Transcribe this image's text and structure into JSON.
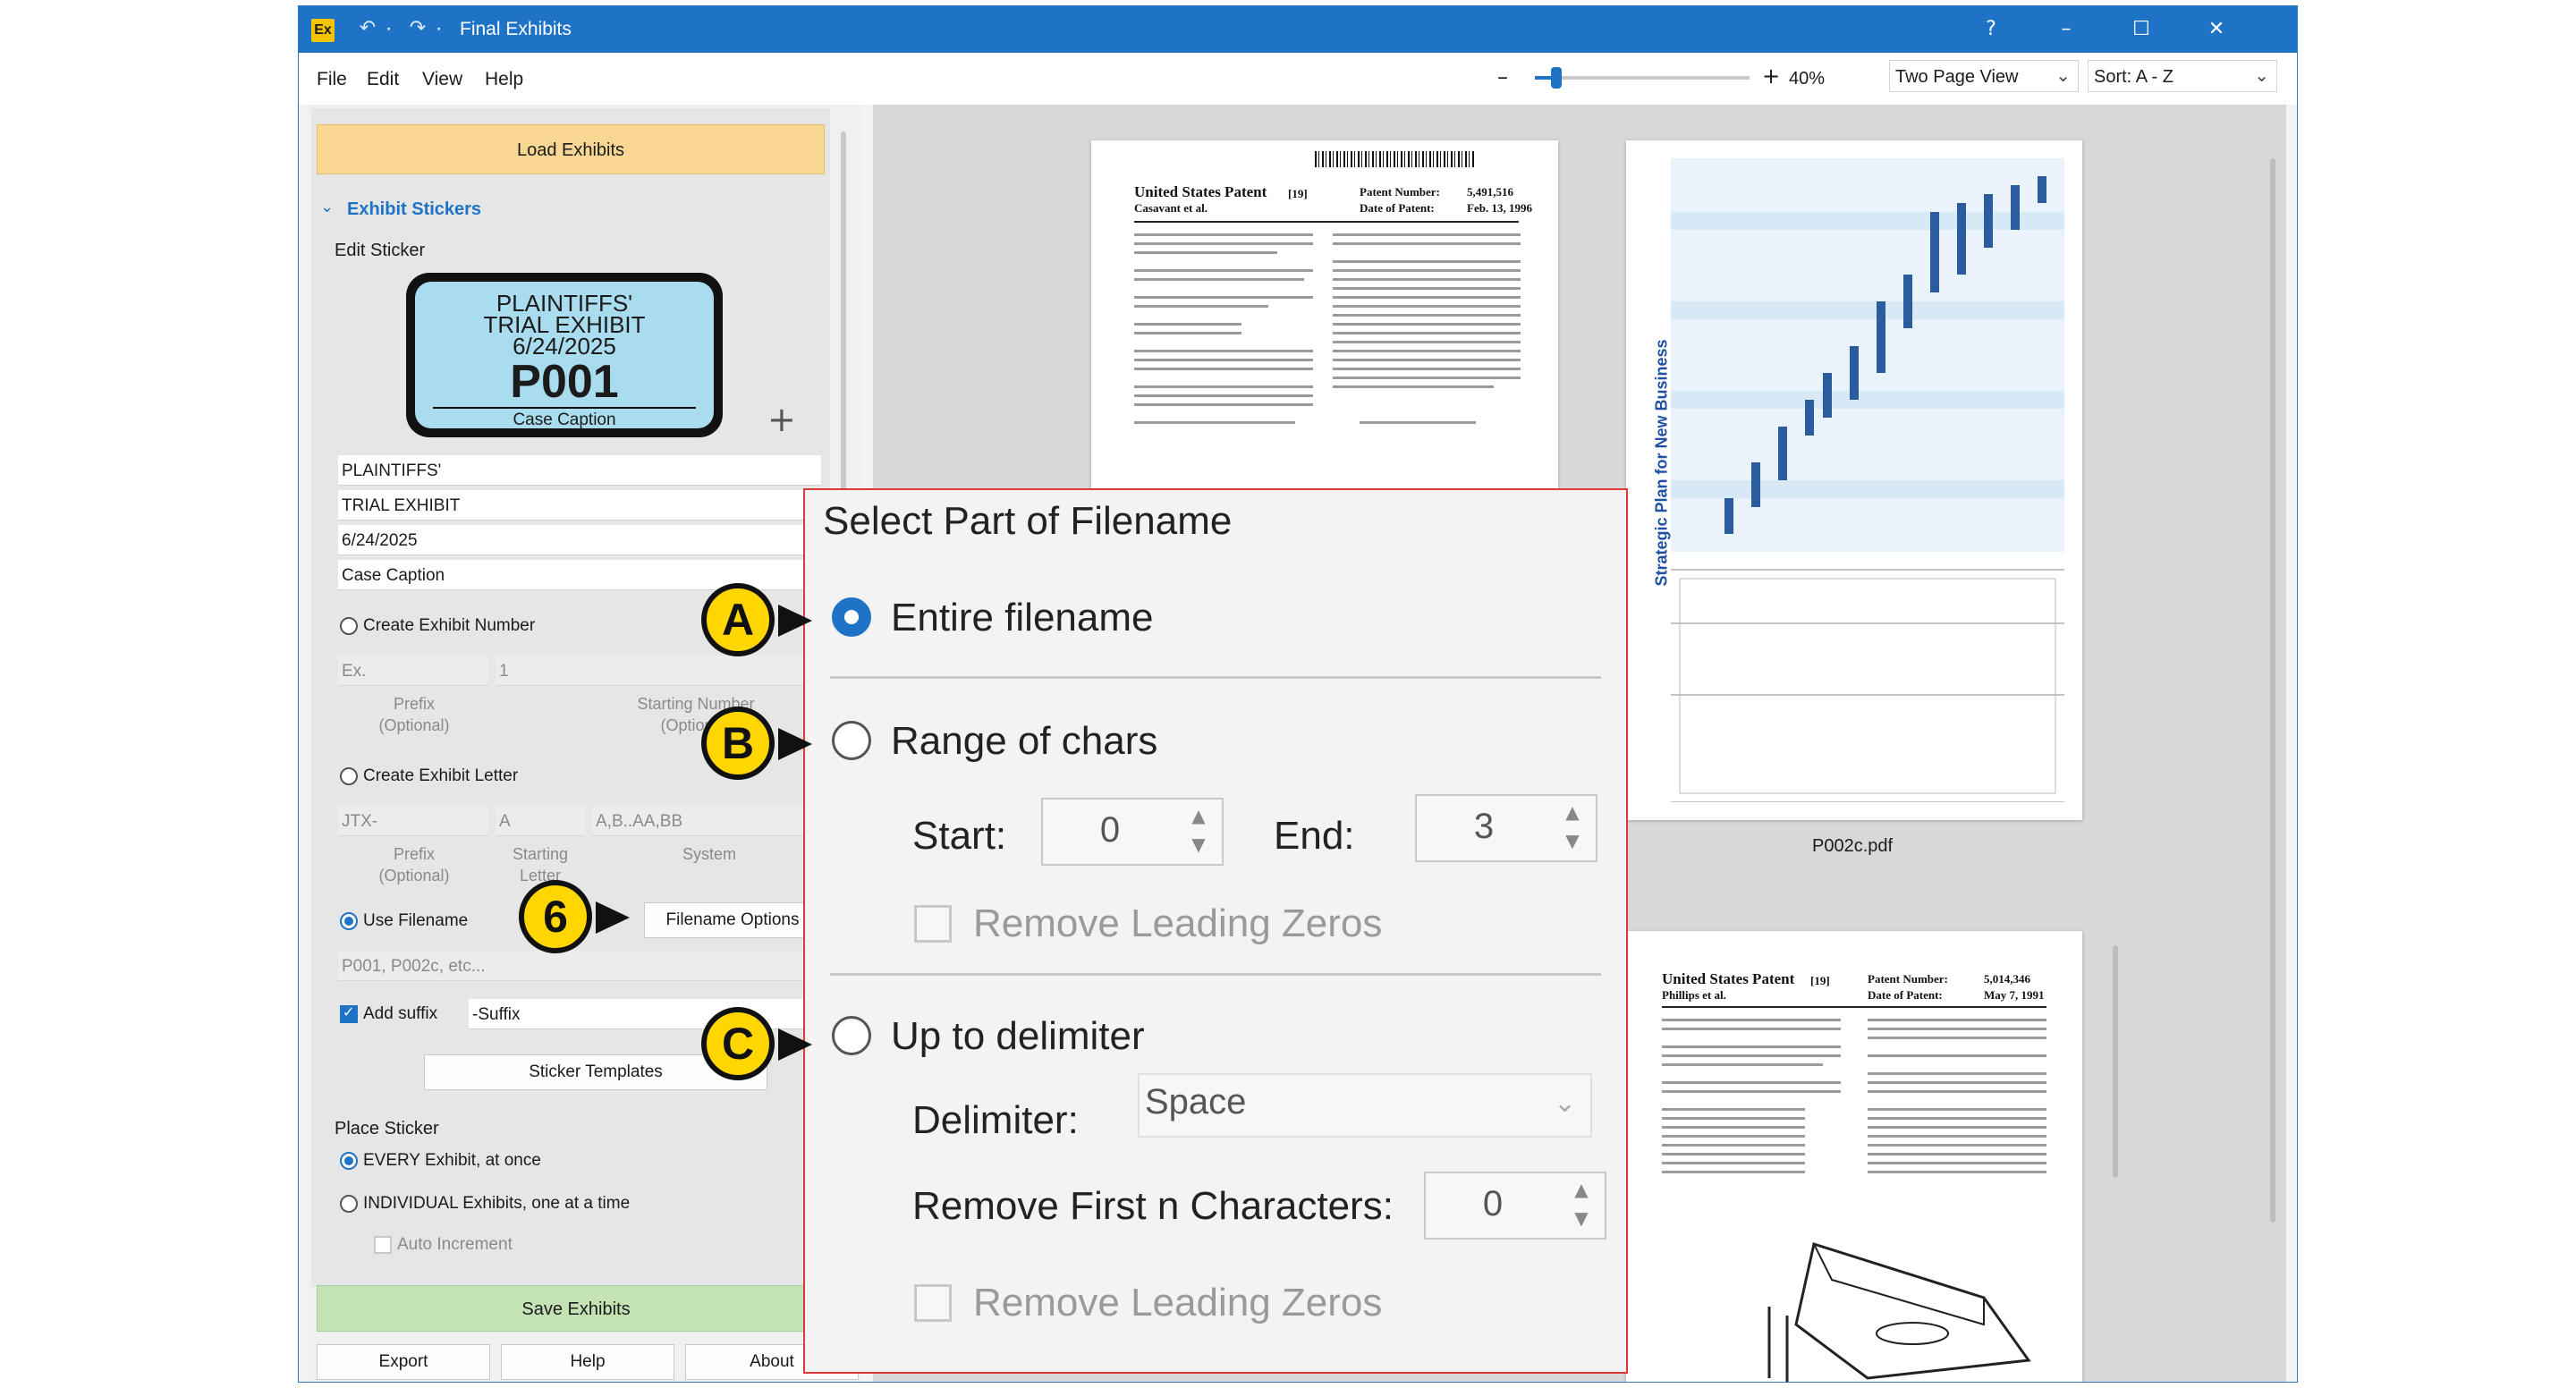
{
  "window": {
    "title": "Final Exhibits",
    "logo": "Ex",
    "controls": {
      "help": "?",
      "minimize": "–",
      "maximize": "☐",
      "close": "✕"
    }
  },
  "menu": {
    "file": "File",
    "edit": "Edit",
    "view": "View",
    "help": "Help"
  },
  "toolbar": {
    "zoom_minus": "–",
    "zoom_plus": "+",
    "zoom_value": "40%",
    "zoom_level": 0.1,
    "view_mode": "Two Page View",
    "sort": "Sort: A - Z"
  },
  "left_panel": {
    "load_button": "Load Exhibits",
    "section_title": "Exhibit Stickers",
    "edit_sticker_label": "Edit Sticker",
    "sticker": {
      "line1": "PLAINTIFFS'",
      "line2": "TRIAL EXHIBIT",
      "line3": "6/24/2025",
      "number": "P001",
      "caption": "Case Caption"
    },
    "fields": {
      "line1": "PLAINTIFFS'",
      "line2": "TRIAL EXHIBIT",
      "line3": "6/24/2025",
      "line4": "Case Caption"
    },
    "create_number": {
      "label": "Create Exhibit Number",
      "prefix_value": "Ex.",
      "start_value": "1",
      "prefix_caption_1": "Prefix",
      "prefix_caption_2": "(Optional)",
      "start_caption_1": "Starting Number",
      "start_caption_2": "(Optional)"
    },
    "create_letter": {
      "label": "Create Exhibit Letter",
      "prefix_value": "JTX-",
      "start_value": "A",
      "system_value": "A,B..AA,BB",
      "prefix_caption_1": "Prefix",
      "prefix_caption_2": "(Optional)",
      "start_caption_1": "Starting",
      "start_caption_2": "Letter",
      "system_caption": "System"
    },
    "use_filename": {
      "label": "Use Filename",
      "options_button": "Filename Options",
      "placeholder": "P001, P002c, etc..."
    },
    "add_suffix": {
      "label": "Add suffix",
      "value": "-Suffix"
    },
    "sticker_templates_button": "Sticker Templates",
    "place_sticker": {
      "title": "Place Sticker",
      "every": "EVERY Exhibit, at once",
      "individual": "INDIVIDUAL Exhibits, one at a time",
      "auto_increment": "Auto Increment"
    },
    "save_button": "Save Exhibits",
    "bottom_buttons": {
      "export": "Export",
      "help": "Help",
      "about": "About"
    }
  },
  "viewer": {
    "page1": {
      "header": "United States Patent",
      "tag": "[19]",
      "inventor": "Casavant et al.",
      "patent_number_label": "Patent Number:",
      "patent_number": "5,491,516",
      "date_label": "Date of Patent:",
      "date": "Feb. 13, 1996"
    },
    "page2": {
      "chart_title": "Strategic Plan for New Business",
      "filename": "P002c.pdf"
    },
    "page3": {
      "header": "United States Patent",
      "tag": "[19]",
      "inventor": "Phillips et al.",
      "patent_number_label": "Patent Number:",
      "patent_number": "5,014,346",
      "date_label": "Date of Patent:",
      "date": "May 7, 1991"
    }
  },
  "dialog": {
    "title": "Select Part of Filename",
    "option_a": "Entire filename",
    "option_b": "Range of chars",
    "start_label": "Start:",
    "start_value": "0",
    "end_label": "End:",
    "end_value": "3",
    "remove_zeros_b": "Remove Leading Zeros",
    "option_c": "Up to delimiter",
    "delimiter_label": "Delimiter:",
    "delimiter_value": "Space",
    "remove_first_label": "Remove First n Characters:",
    "remove_first_value": "0",
    "remove_zeros_c": "Remove Leading Zeros"
  },
  "callouts": {
    "a": "A",
    "b": "B",
    "c": "C",
    "six": "6"
  }
}
